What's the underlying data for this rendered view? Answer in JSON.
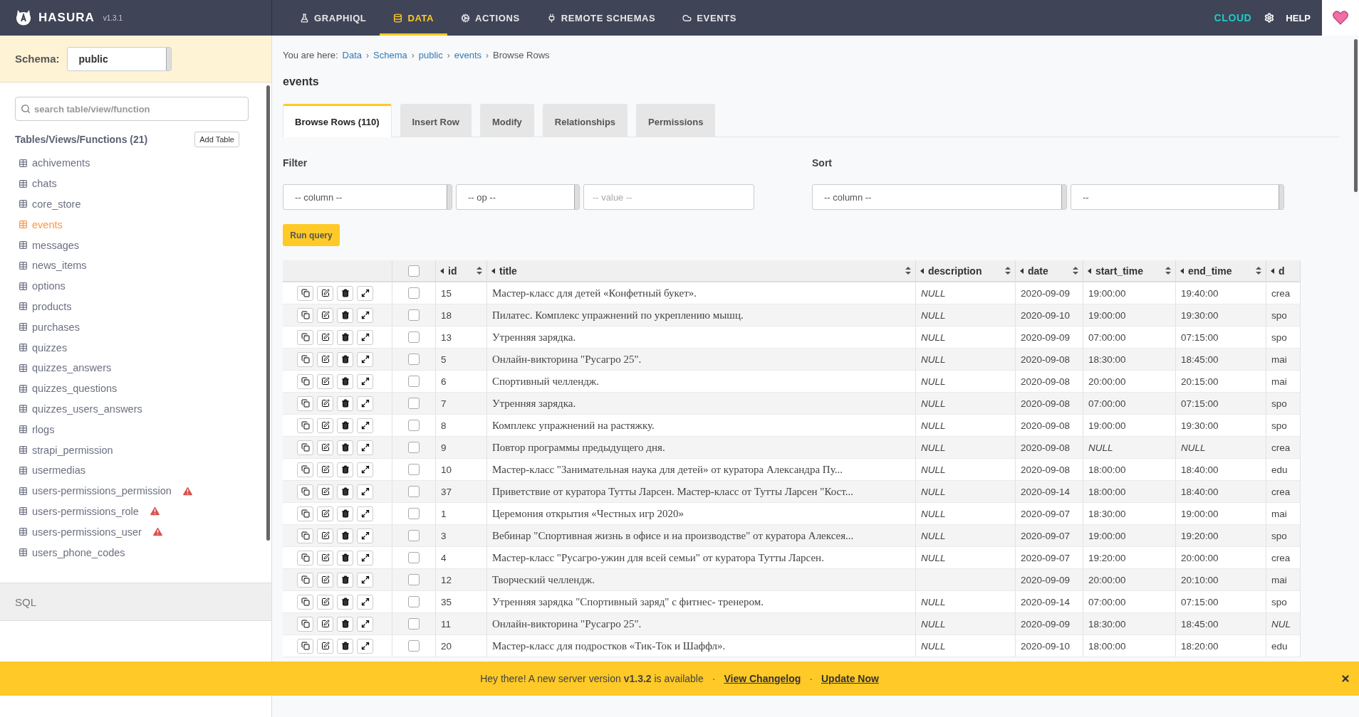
{
  "topbar": {
    "brand": "HASURA",
    "version": "v1.3.1",
    "nav": [
      {
        "label": "GRAPHIQL",
        "selected": false
      },
      {
        "label": "DATA",
        "selected": true
      },
      {
        "label": "ACTIONS",
        "selected": false
      },
      {
        "label": "REMOTE SCHEMAS",
        "selected": false
      },
      {
        "label": "EVENTS",
        "selected": false
      }
    ],
    "cloud": "CLOUD",
    "help": "HELP"
  },
  "sidebar": {
    "schema_label": "Schema:",
    "schema_value": "public",
    "search": {
      "placeholder": "search table/view/function"
    },
    "heading": "Tables/Views/Functions (21)",
    "add_button": "Add Table",
    "items": [
      {
        "label": "achivements",
        "selected": false,
        "warning": false
      },
      {
        "label": "chats",
        "selected": false,
        "warning": false
      },
      {
        "label": "core_store",
        "selected": false,
        "warning": false
      },
      {
        "label": "events",
        "selected": true,
        "warning": false
      },
      {
        "label": "messages",
        "selected": false,
        "warning": false
      },
      {
        "label": "news_items",
        "selected": false,
        "warning": false
      },
      {
        "label": "options",
        "selected": false,
        "warning": false
      },
      {
        "label": "products",
        "selected": false,
        "warning": false
      },
      {
        "label": "purchases",
        "selected": false,
        "warning": false
      },
      {
        "label": "quizzes",
        "selected": false,
        "warning": false
      },
      {
        "label": "quizzes_answers",
        "selected": false,
        "warning": false
      },
      {
        "label": "quizzes_questions",
        "selected": false,
        "warning": false
      },
      {
        "label": "quizzes_users_answers",
        "selected": false,
        "warning": false
      },
      {
        "label": "rlogs",
        "selected": false,
        "warning": false
      },
      {
        "label": "strapi_permission",
        "selected": false,
        "warning": false
      },
      {
        "label": "usermedias",
        "selected": false,
        "warning": false
      },
      {
        "label": "users-permissions_permission",
        "selected": false,
        "warning": true
      },
      {
        "label": "users-permissions_role",
        "selected": false,
        "warning": true
      },
      {
        "label": "users-permissions_user",
        "selected": false,
        "warning": true
      },
      {
        "label": "users_phone_codes",
        "selected": false,
        "warning": false
      }
    ],
    "sql": "SQL"
  },
  "breadcrumb": {
    "prefix": "You are here:",
    "separator": "›",
    "links": [
      "Data",
      "Schema",
      "public",
      "events"
    ],
    "current": "Browse Rows"
  },
  "title": "events",
  "tabs": [
    {
      "label": "Browse Rows (110)",
      "selected": true
    },
    {
      "label": "Insert Row",
      "selected": false
    },
    {
      "label": "Modify",
      "selected": false
    },
    {
      "label": "Relationships",
      "selected": false
    },
    {
      "label": "Permissions",
      "selected": false
    }
  ],
  "filter": {
    "label": "Filter",
    "column": "-- column --",
    "op": "-- op --",
    "value": {
      "placeholder": "-- value --"
    }
  },
  "sort": {
    "label": "Sort",
    "column": "-- column --",
    "order": "--"
  },
  "run_button": "Run query",
  "table": {
    "select_all_checked": false,
    "columns": [
      "id",
      "title",
      "description",
      "date",
      "start_time",
      "end_time",
      "d"
    ],
    "rows": [
      {
        "checked": false,
        "cells": [
          {
            "text": "15",
            "kind": "value"
          },
          {
            "text": "Мастер-класс для детей «Конфетный букет».",
            "kind": "title"
          },
          {
            "text": "NULL",
            "kind": "null"
          },
          {
            "text": "2020-09-09",
            "kind": "value"
          },
          {
            "text": "19:00:00",
            "kind": "value"
          },
          {
            "text": "19:40:00",
            "kind": "value"
          },
          {
            "text": "crea",
            "kind": "value"
          }
        ]
      },
      {
        "checked": false,
        "cells": [
          {
            "text": "18",
            "kind": "value"
          },
          {
            "text": "Пилатес. Комплекс упражнений по укреплению мышц.",
            "kind": "title"
          },
          {
            "text": "NULL",
            "kind": "null"
          },
          {
            "text": "2020-09-10",
            "kind": "value"
          },
          {
            "text": "19:00:00",
            "kind": "value"
          },
          {
            "text": "19:30:00",
            "kind": "value"
          },
          {
            "text": "spo",
            "kind": "value"
          }
        ]
      },
      {
        "checked": false,
        "cells": [
          {
            "text": "13",
            "kind": "value"
          },
          {
            "text": "Утренняя зарядка.",
            "kind": "title"
          },
          {
            "text": "NULL",
            "kind": "null"
          },
          {
            "text": "2020-09-09",
            "kind": "value"
          },
          {
            "text": "07:00:00",
            "kind": "value"
          },
          {
            "text": "07:15:00",
            "kind": "value"
          },
          {
            "text": "spo",
            "kind": "value"
          }
        ]
      },
      {
        "checked": false,
        "cells": [
          {
            "text": "5",
            "kind": "value"
          },
          {
            "text": "Онлайн-викторина \"Русагро 25\".",
            "kind": "title"
          },
          {
            "text": "NULL",
            "kind": "null"
          },
          {
            "text": "2020-09-08",
            "kind": "value"
          },
          {
            "text": "18:30:00",
            "kind": "value"
          },
          {
            "text": "18:45:00",
            "kind": "value"
          },
          {
            "text": "mai",
            "kind": "value"
          }
        ]
      },
      {
        "checked": false,
        "cells": [
          {
            "text": "6",
            "kind": "value"
          },
          {
            "text": "Спортивный челлендж.",
            "kind": "title"
          },
          {
            "text": "NULL",
            "kind": "null"
          },
          {
            "text": "2020-09-08",
            "kind": "value"
          },
          {
            "text": "20:00:00",
            "kind": "value"
          },
          {
            "text": "20:15:00",
            "kind": "value"
          },
          {
            "text": "mai",
            "kind": "value"
          }
        ]
      },
      {
        "checked": false,
        "cells": [
          {
            "text": "7",
            "kind": "value"
          },
          {
            "text": "Утренняя зарядка.",
            "kind": "title"
          },
          {
            "text": "NULL",
            "kind": "null"
          },
          {
            "text": "2020-09-08",
            "kind": "value"
          },
          {
            "text": "07:00:00",
            "kind": "value"
          },
          {
            "text": "07:15:00",
            "kind": "value"
          },
          {
            "text": "spo",
            "kind": "value"
          }
        ]
      },
      {
        "checked": false,
        "cells": [
          {
            "text": "8",
            "kind": "value"
          },
          {
            "text": "Комплекс упражнений на растяжку.",
            "kind": "title"
          },
          {
            "text": "NULL",
            "kind": "null"
          },
          {
            "text": "2020-09-08",
            "kind": "value"
          },
          {
            "text": "19:00:00",
            "kind": "value"
          },
          {
            "text": "19:30:00",
            "kind": "value"
          },
          {
            "text": "spo",
            "kind": "value"
          }
        ]
      },
      {
        "checked": false,
        "cells": [
          {
            "text": "9",
            "kind": "value"
          },
          {
            "text": "Повтор программы предыдущего дня.",
            "kind": "title"
          },
          {
            "text": "NULL",
            "kind": "null"
          },
          {
            "text": "2020-09-08",
            "kind": "value"
          },
          {
            "text": "NULL",
            "kind": "null"
          },
          {
            "text": "NULL",
            "kind": "null"
          },
          {
            "text": "crea",
            "kind": "value"
          }
        ]
      },
      {
        "checked": false,
        "cells": [
          {
            "text": "10",
            "kind": "value"
          },
          {
            "text": "Мастер-класс \"Занимательная наука для детей» от куратора Александра Пу...",
            "kind": "title"
          },
          {
            "text": "NULL",
            "kind": "null"
          },
          {
            "text": "2020-09-08",
            "kind": "value"
          },
          {
            "text": "18:00:00",
            "kind": "value"
          },
          {
            "text": "18:40:00",
            "kind": "value"
          },
          {
            "text": "edu",
            "kind": "value"
          }
        ]
      },
      {
        "checked": false,
        "cells": [
          {
            "text": "37",
            "kind": "value"
          },
          {
            "text": "Приветствие от куратора Тутты Ларсен. Мастер-класс от Тутты Ларсен \"Кост...",
            "kind": "title"
          },
          {
            "text": "NULL",
            "kind": "null"
          },
          {
            "text": "2020-09-14",
            "kind": "value"
          },
          {
            "text": "18:00:00",
            "kind": "value"
          },
          {
            "text": "18:40:00",
            "kind": "value"
          },
          {
            "text": "crea",
            "kind": "value"
          }
        ]
      },
      {
        "checked": false,
        "cells": [
          {
            "text": "1",
            "kind": "value"
          },
          {
            "text": "Церемония открытия «Честных игр 2020»",
            "kind": "title"
          },
          {
            "text": "NULL",
            "kind": "null"
          },
          {
            "text": "2020-09-07",
            "kind": "value"
          },
          {
            "text": "18:30:00",
            "kind": "value"
          },
          {
            "text": "19:00:00",
            "kind": "value"
          },
          {
            "text": "mai",
            "kind": "value"
          }
        ]
      },
      {
        "checked": false,
        "cells": [
          {
            "text": "3",
            "kind": "value"
          },
          {
            "text": "Вебинар \"Спортивная жизнь в офисе и на производстве\" от куратора Алексея...",
            "kind": "title"
          },
          {
            "text": "NULL",
            "kind": "null"
          },
          {
            "text": "2020-09-07",
            "kind": "value"
          },
          {
            "text": "19:00:00",
            "kind": "value"
          },
          {
            "text": "19:20:00",
            "kind": "value"
          },
          {
            "text": "spo",
            "kind": "value"
          }
        ]
      },
      {
        "checked": false,
        "cells": [
          {
            "text": "4",
            "kind": "value"
          },
          {
            "text": "Мастер-класс \"Русагро-ужин для всей семьи\" от куратора Тутты Ларсен.",
            "kind": "title"
          },
          {
            "text": "NULL",
            "kind": "null"
          },
          {
            "text": "2020-09-07",
            "kind": "value"
          },
          {
            "text": "19:20:00",
            "kind": "value"
          },
          {
            "text": "20:00:00",
            "kind": "value"
          },
          {
            "text": "crea",
            "kind": "value"
          }
        ]
      },
      {
        "checked": false,
        "cells": [
          {
            "text": "12",
            "kind": "value"
          },
          {
            "text": "Творческий челлендж.",
            "kind": "title"
          },
          {
            "kind": "empty"
          },
          {
            "text": "2020-09-09",
            "kind": "value"
          },
          {
            "text": "20:00:00",
            "kind": "value"
          },
          {
            "text": "20:10:00",
            "kind": "value"
          },
          {
            "text": "mai",
            "kind": "value"
          }
        ]
      },
      {
        "checked": false,
        "cells": [
          {
            "text": "35",
            "kind": "value"
          },
          {
            "text": "Утренняя зарядка \"Спортивный заряд\" с фитнес- тренером.",
            "kind": "title"
          },
          {
            "text": "NULL",
            "kind": "null"
          },
          {
            "text": "2020-09-14",
            "kind": "value"
          },
          {
            "text": "07:00:00",
            "kind": "value"
          },
          {
            "text": "07:15:00",
            "kind": "value"
          },
          {
            "text": "spo",
            "kind": "value"
          }
        ]
      },
      {
        "checked": false,
        "cells": [
          {
            "text": "11",
            "kind": "value"
          },
          {
            "text": "Онлайн-викторина \"Русагро 25\".",
            "kind": "title"
          },
          {
            "text": "NULL",
            "kind": "null"
          },
          {
            "text": "2020-09-09",
            "kind": "value"
          },
          {
            "text": "18:30:00",
            "kind": "value"
          },
          {
            "text": "18:45:00",
            "kind": "value"
          },
          {
            "text": "NUL",
            "kind": "null"
          }
        ]
      },
      {
        "checked": false,
        "cells": [
          {
            "text": "20",
            "kind": "value"
          },
          {
            "text": "Мастер-класс для подростков «Тик-Ток и Шаффл».",
            "kind": "title"
          },
          {
            "text": "NULL",
            "kind": "null"
          },
          {
            "text": "2020-09-10",
            "kind": "value"
          },
          {
            "text": "18:00:00",
            "kind": "value"
          },
          {
            "text": "18:20:00",
            "kind": "value"
          },
          {
            "text": "edu",
            "kind": "value"
          }
        ]
      }
    ]
  },
  "banner": {
    "message": "Hey there! A new server version **v1.3.2** is available",
    "separator": "·",
    "links": [
      "View Changelog",
      "Update Now"
    ]
  }
}
